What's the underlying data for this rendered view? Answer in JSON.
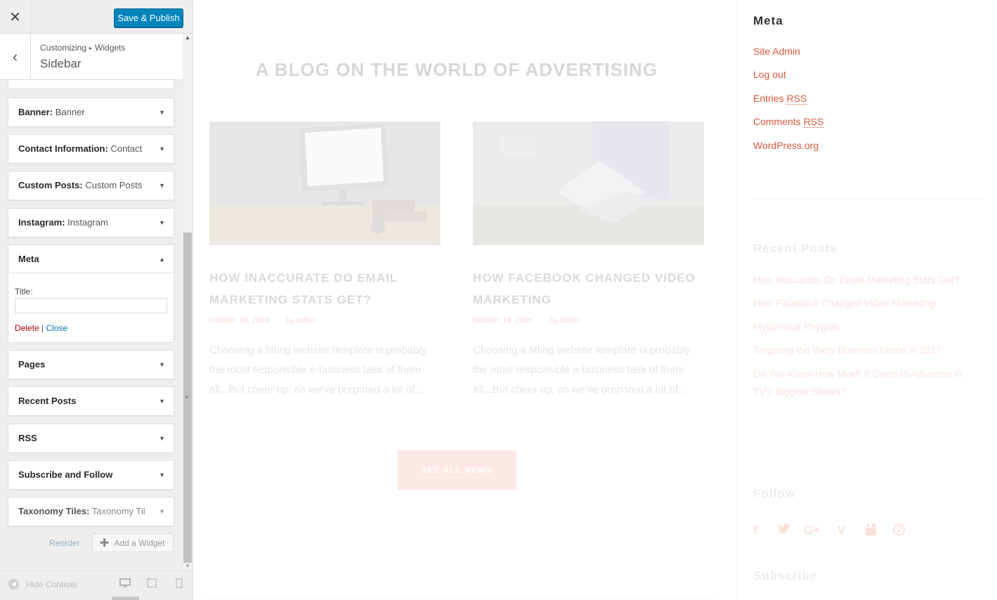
{
  "topbar": {
    "close_label": "✕",
    "publish_label": "Save & Publish"
  },
  "section": {
    "back_label": "‹",
    "crumb_root": "Customizing",
    "crumb_sep": "▸",
    "crumb_leaf": "Widgets",
    "title": "Sidebar"
  },
  "widgets": [
    {
      "type": "Banner:",
      "instance": "Banner"
    },
    {
      "type": "Contact Information:",
      "instance": "Contact ..."
    },
    {
      "type": "Custom Posts:",
      "instance": "Custom Posts"
    },
    {
      "type": "Instagram:",
      "instance": "Instagram"
    },
    {
      "type": "Pages",
      "instance": ""
    },
    {
      "type": "Recent Posts",
      "instance": ""
    },
    {
      "type": "RSS",
      "instance": ""
    },
    {
      "type": "Subscribe and Follow",
      "instance": ""
    },
    {
      "type": "Taxonomy Tiles:",
      "instance": "Taxonomy Til..."
    }
  ],
  "meta_widget": {
    "label": "Meta",
    "title_label": "Title:",
    "title_value": "",
    "delete_label": "Delete",
    "separator": "|",
    "close_label": "Close"
  },
  "widget_actions": {
    "reorder_label": "Reorder",
    "add_label": "Add a Widget"
  },
  "footer": {
    "hide_controls_label": "Hide Controls"
  },
  "icons": {
    "collapsed_arrow": "▼",
    "expanded_arrow": "▲",
    "plus": "✚",
    "desktop": "🖥",
    "tablet": "◰",
    "mobile": "▯"
  },
  "preview": {
    "heading": "A BLOG ON THE WORLD OF ADVERTISING",
    "posts": [
      {
        "title": "HOW INACCURATE DO EMAIL MARKETING STATS GET?",
        "date": "October 19, 2016",
        "author": "by admin",
        "excerpt": "Choosing a fitting website template is probably the most responsible e-business task of them all...But cheer up, as we've prepared a lot of..."
      },
      {
        "title": "HOW FACEBOOK CHANGED VIDEO MARKETING",
        "date": "October 19, 2016",
        "author": "by admin",
        "excerpt": "Choosing a fitting website template is probably the most responsible e-business task of them all...But cheer up, as we've prepared a lot of..."
      }
    ],
    "see_all_label": "SEE ALL NEWS",
    "sidebar": {
      "meta_heading": "Meta",
      "meta_links": [
        "Site Admin",
        "Log out",
        "Entries",
        "Comments",
        "WordPress.org"
      ],
      "rss_abbr": "RSS",
      "recent_heading": "Recent Posts",
      "recent_links": [
        "How Inaccurate Do Email Marketing Stats Get?",
        "How Facebook Changed Video Marketing",
        "Mysterious Phygital",
        "Targeting the Baby Boomers Demo in 2017",
        "Do You Know How Much It Costs to Advertise in TV's Biggest Shows?"
      ],
      "follow_heading": "Follow",
      "social_icons": [
        "f",
        "🐦",
        "G+",
        "V",
        "▶",
        "℗"
      ],
      "subscribe_heading": "Subscribe"
    }
  },
  "colors": {
    "publish_blue": "#0085ba",
    "link_red": "#d9583c",
    "delete_red": "#aa0000",
    "close_blue": "#0073aa"
  }
}
